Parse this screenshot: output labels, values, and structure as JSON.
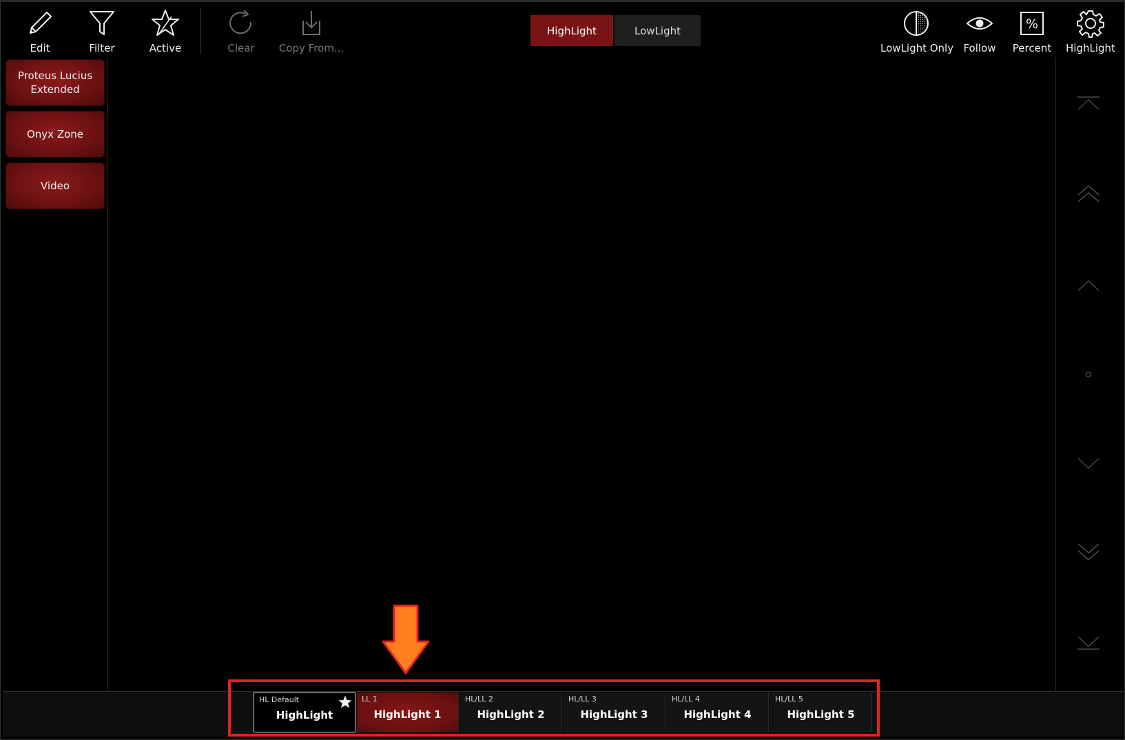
{
  "toolbar": {
    "edit": "Edit",
    "filter": "Filter",
    "active": "Active",
    "clear": "Clear",
    "copy_from": "Copy From...",
    "lowlight_only": "LowLight Only",
    "follow": "Follow",
    "percent": "Percent",
    "highlight_settings": "HighLight"
  },
  "mode_toggle": {
    "highlight": "HighLight",
    "lowlight": "LowLight",
    "selected": "HighLight"
  },
  "sidebar": {
    "items": [
      {
        "label": "Proteus Lucius Extended",
        "line1": "Proteus Lucius",
        "line2": "Extended"
      },
      {
        "label": "Onyx Zone"
      },
      {
        "label": "Video"
      }
    ]
  },
  "highlight_tabs": [
    {
      "small": "HL Default",
      "big": "HighLight"
    },
    {
      "small": "LL 1",
      "big": "HighLight 1"
    },
    {
      "small": "HL/LL 2",
      "big": "HighLight 2"
    },
    {
      "small": "HL/LL 3",
      "big": "HighLight 3"
    },
    {
      "small": "HL/LL 4",
      "big": "HighLight 4"
    },
    {
      "small": "HL/LL 5",
      "big": "HighLight 5"
    }
  ],
  "colors": {
    "accent_red": "#7a1414",
    "annotation_red": "#e02323",
    "annotation_arrow": "#ff7f20"
  }
}
